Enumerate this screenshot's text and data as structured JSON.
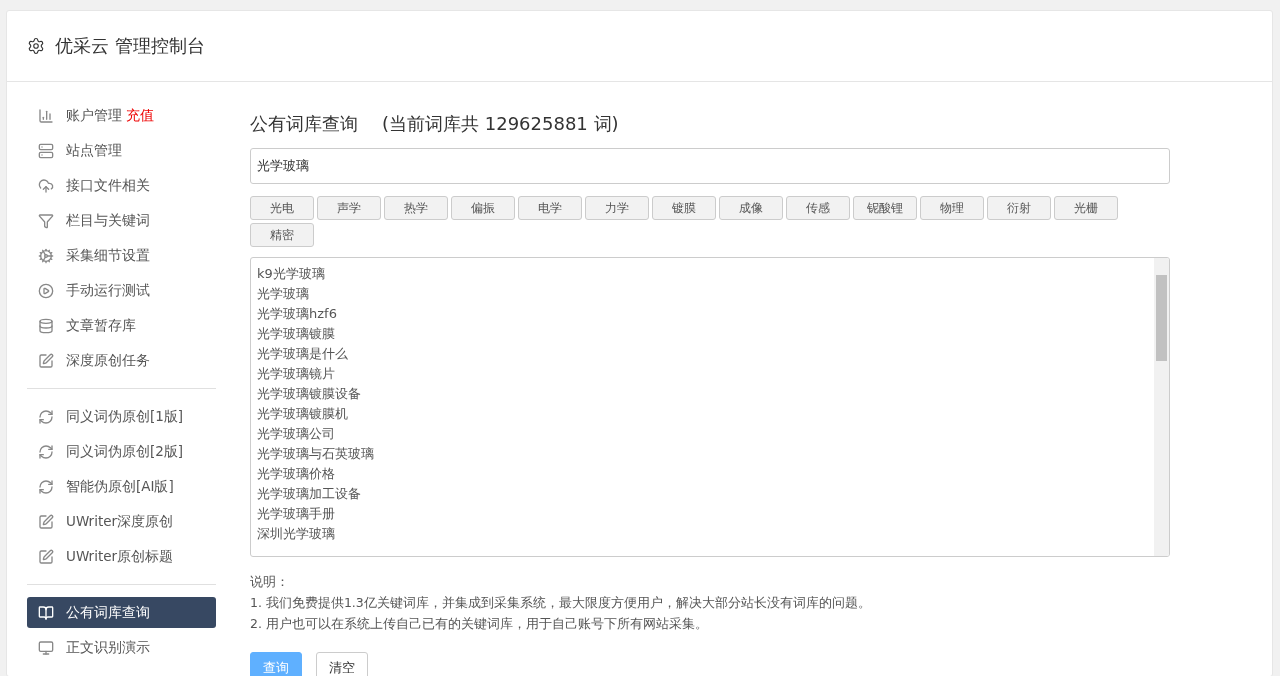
{
  "header": {
    "title": "优采云 管理控制台"
  },
  "sidebar": {
    "groups": [
      {
        "items": [
          {
            "label": "账户管理",
            "badge": "充值",
            "selected": false
          },
          {
            "label": "站点管理",
            "selected": false
          },
          {
            "label": "接口文件相关",
            "selected": false
          },
          {
            "label": "栏目与关键词",
            "selected": false
          },
          {
            "label": "采集细节设置",
            "selected": false
          },
          {
            "label": "手动运行测试",
            "selected": false
          },
          {
            "label": "文章暂存库",
            "selected": false
          },
          {
            "label": "深度原创任务",
            "selected": false
          }
        ]
      },
      {
        "items": [
          {
            "label": "同义词伪原创[1版]",
            "selected": false
          },
          {
            "label": "同义词伪原创[2版]",
            "selected": false
          },
          {
            "label": "智能伪原创[AI版]",
            "selected": false
          },
          {
            "label": "UWriter深度原创",
            "selected": false
          },
          {
            "label": "UWriter原创标题",
            "selected": false
          }
        ]
      },
      {
        "items": [
          {
            "label": "公有词库查询",
            "selected": true
          },
          {
            "label": "正文识别演示",
            "selected": false
          }
        ]
      }
    ]
  },
  "main": {
    "title": "公有词库查询",
    "subtitle": "(当前词库共 129625881 词)",
    "search": {
      "value": "光学玻璃"
    },
    "tags": [
      "光电",
      "声学",
      "热学",
      "偏振",
      "电学",
      "力学",
      "镀膜",
      "成像",
      "传感",
      "铌酸锂",
      "物理",
      "衍射",
      "光栅",
      "精密"
    ],
    "results": [
      "k9光学玻璃",
      "光学玻璃",
      "光学玻璃hzf6",
      "光学玻璃镀膜",
      "光学玻璃是什么",
      "光学玻璃镜片",
      "光学玻璃镀膜设备",
      "光学玻璃镀膜机",
      "光学玻璃公司",
      "光学玻璃与石英玻璃",
      "光学玻璃价格",
      "光学玻璃加工设备",
      "光学玻璃手册",
      "深圳光学玻璃"
    ],
    "notes_title": "说明：",
    "notes": [
      "1. 我们免费提供1.3亿关键词库，并集成到采集系统，最大限度方便用户，解决大部分站长没有词库的问题。",
      "2. 用户也可以在系统上传自己已有的关键词库，用于自己账号下所有网站采集。"
    ],
    "buttons": [
      {
        "label": "查询",
        "kind": "primary"
      },
      {
        "label": "清空",
        "kind": "default"
      }
    ]
  }
}
